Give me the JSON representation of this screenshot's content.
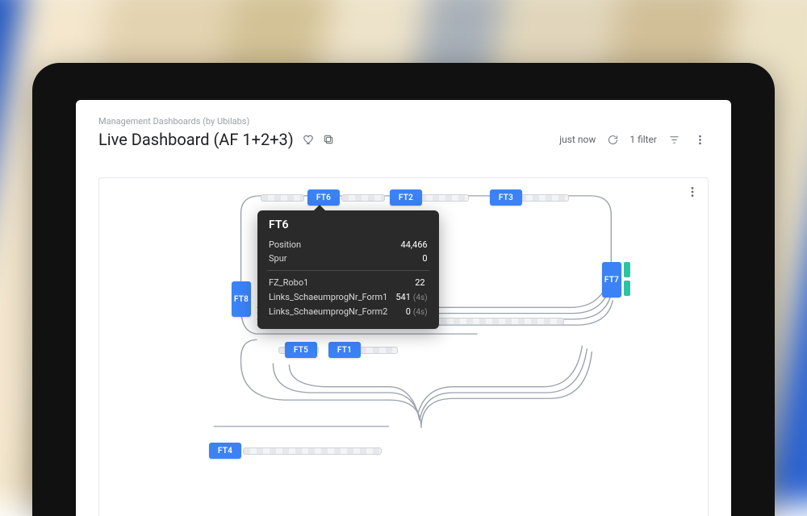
{
  "breadcrumb": "Management Dashboards (by Ubilabs)",
  "title": "Live Dashboard (AF 1+2+3)",
  "header_actions": {
    "refresh_label": "just now",
    "filter_label": "1 filter"
  },
  "nodes": {
    "ft1": "FT1",
    "ft2": "FT2",
    "ft3": "FT3",
    "ft4": "FT4",
    "ft5": "FT5",
    "ft6": "FT6",
    "ft7": "FT7",
    "ft8": "FT8"
  },
  "tooltip": {
    "title": "FT6",
    "rows_a": [
      {
        "k": "Position",
        "v": "44,466"
      },
      {
        "k": "Spur",
        "v": "0"
      }
    ],
    "rows_b": [
      {
        "k": "FZ_Robo1",
        "v": "22",
        "sub": ""
      },
      {
        "k": "Links_SchaeumprogNr_Form1",
        "v": "541",
        "sub": "(4s)"
      },
      {
        "k": "Links_SchaeumprogNr_Form2",
        "v": "0",
        "sub": "(4s)"
      }
    ]
  }
}
